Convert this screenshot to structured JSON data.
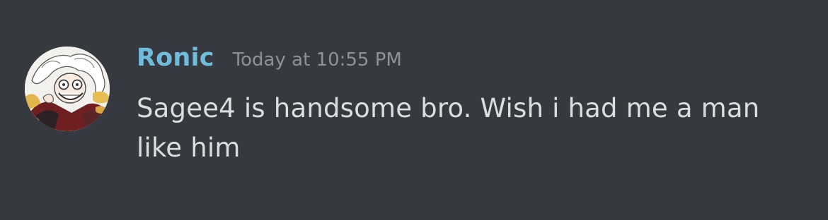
{
  "message": {
    "author": "Ronic",
    "timestamp": "Today at 10:55 PM",
    "text": "Sagee4 is handsome bro. Wish i had me a man like him",
    "avatar_icon": "anime-character-avatar-icon"
  },
  "colors": {
    "background": "#36393f",
    "username": "#6fbcdc",
    "timestamp": "#8e9297",
    "message_text": "#dcddde"
  }
}
